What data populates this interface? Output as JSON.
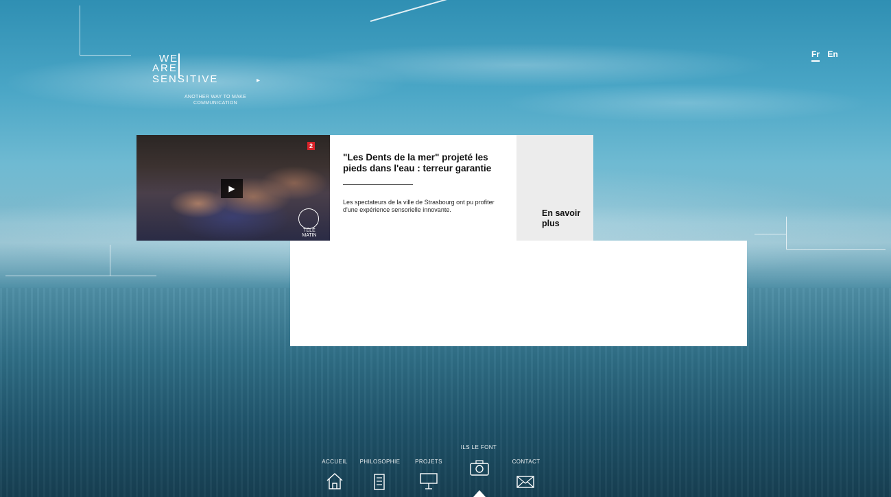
{
  "logo": {
    "line1": "WE",
    "line2": "ARE",
    "line3": "SENSITIVE",
    "tagline": "ANOTHER WAY TO MAKE COMMUNICATION"
  },
  "lang": {
    "fr": "Fr",
    "en": "En"
  },
  "card": {
    "channel": "2",
    "thumb_label": "TÉLÉ MATIN",
    "title": "\"Les Dents de la mer\" projeté les pieds dans l'eau : terreur garantie",
    "description": "Les spectateurs de la ville de Strasbourg ont pu profiter d'une expérience sensorielle innovante.",
    "more": "En savoir plus"
  },
  "nav": {
    "accueil": "ACCUEIL",
    "philosophie": "PHILOSOPHIE",
    "projets": "PROJETS",
    "ils_le_font": "ILS LE FONT",
    "contact": "CONTACT"
  },
  "icons": {
    "home": "home-icon",
    "book": "book-icon",
    "projects": "presentation-board-icon",
    "camera": "camera-icon",
    "mail": "mail-icon"
  }
}
